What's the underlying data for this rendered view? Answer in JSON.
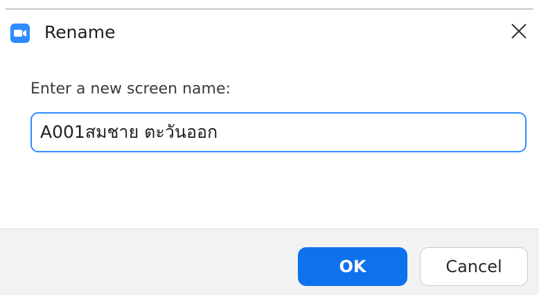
{
  "window": {
    "title": "Rename",
    "app_icon": "zoom-camera-icon",
    "close_icon": "close-icon"
  },
  "form": {
    "prompt": "Enter a new screen name:",
    "name_value": "A001สมชาย ตะวันออก"
  },
  "footer": {
    "ok_label": "OK",
    "cancel_label": "Cancel"
  },
  "colors": {
    "accent": "#0e72ed",
    "input_border": "#2d8cff",
    "footer_bg": "#f2f2f2"
  }
}
